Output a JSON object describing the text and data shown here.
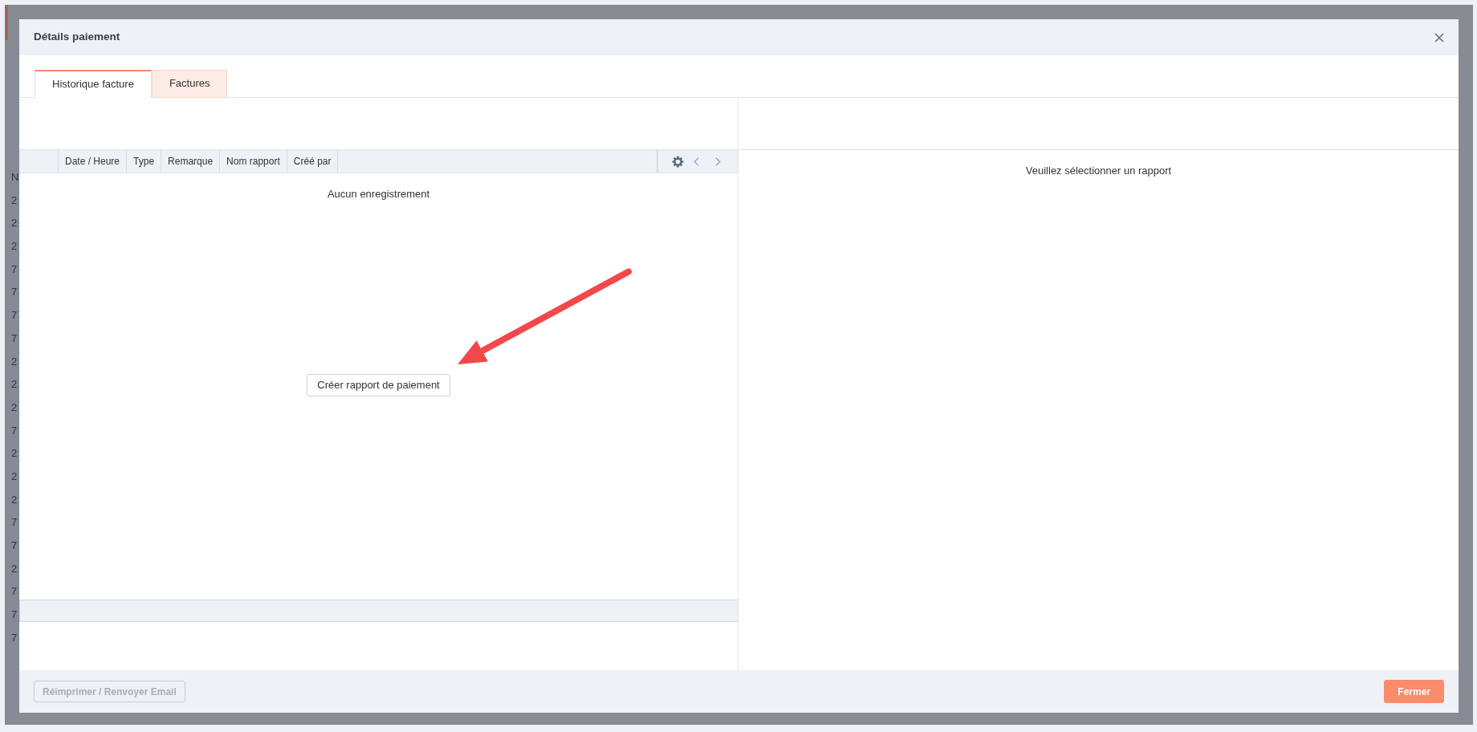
{
  "background_page": {
    "column_heading": "N",
    "rows": [
      "2",
      "2",
      "2",
      "7",
      "7",
      "7",
      "7",
      "2",
      "2",
      "2",
      "7",
      "2",
      "2",
      "2",
      "7",
      "7",
      "2",
      "7",
      "7",
      "7"
    ]
  },
  "dialog": {
    "title": "Détails paiement"
  },
  "tabs": [
    {
      "label": "Historique facture",
      "selected": true
    },
    {
      "label": "Factures",
      "selected": false
    }
  ],
  "table": {
    "columns": [
      "Date / Heure",
      "Type",
      "Remarque",
      "Nom rapport",
      "Créé par"
    ],
    "empty_message": "Aucun enregistrement",
    "action_button": "Créer rapport de paiement"
  },
  "detail_panel": {
    "message": "Veuillez sélectionner un rapport"
  },
  "footer": {
    "buttons": [
      {
        "label": "Réimprimer / Renvoyer Email",
        "kind": "secondary",
        "disabled": true
      },
      {
        "label": "Fermer",
        "kind": "primary",
        "disabled": false
      }
    ]
  }
}
